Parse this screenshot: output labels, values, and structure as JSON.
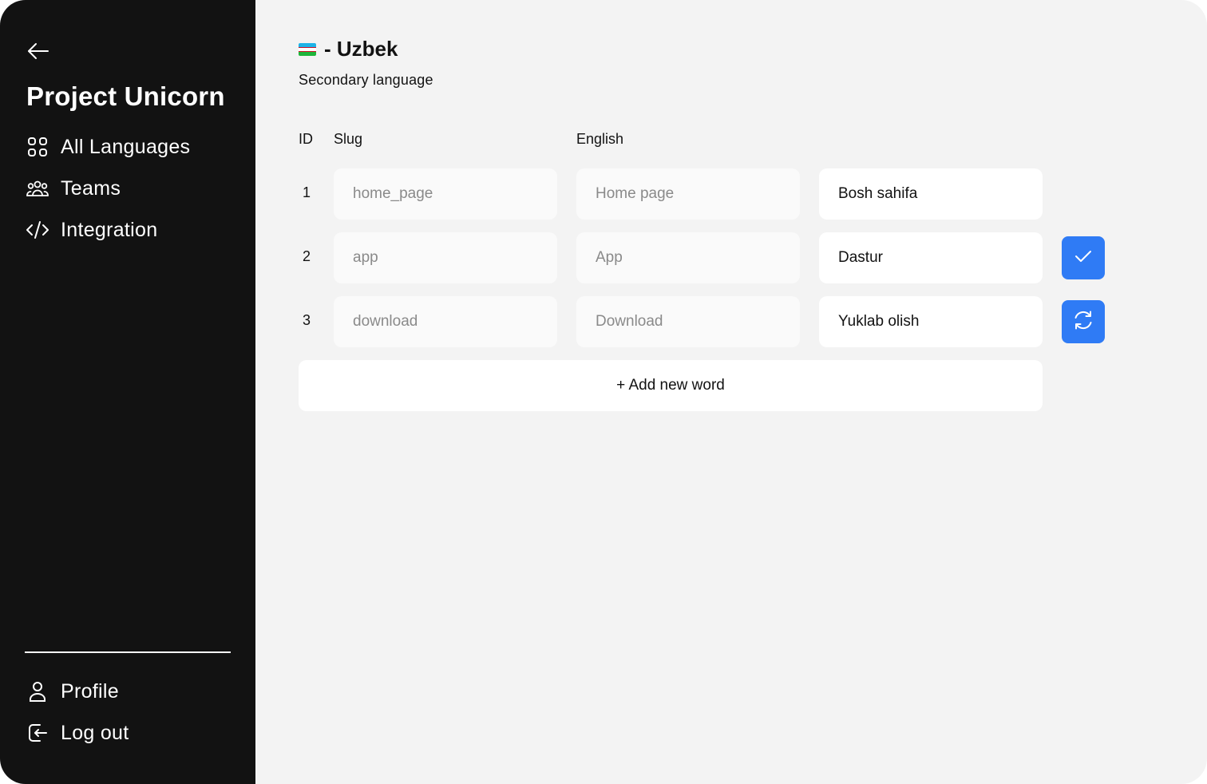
{
  "sidebar": {
    "project_title": "Project Unicorn",
    "nav": [
      {
        "label": "All Languages",
        "icon": "grid-icon"
      },
      {
        "label": "Teams",
        "icon": "users-icon"
      },
      {
        "label": "Integration",
        "icon": "code-icon"
      }
    ],
    "bottom_nav": [
      {
        "label": "Profile",
        "icon": "user-icon"
      },
      {
        "label": "Log out",
        "icon": "logout-icon"
      }
    ]
  },
  "language": {
    "flag": "uzbekistan-flag",
    "title": "- Uzbek",
    "subtitle": "Secondary language"
  },
  "table": {
    "headers": {
      "id": "ID",
      "slug": "Slug",
      "english": "English"
    },
    "rows": [
      {
        "id": "1",
        "slug": "home_page",
        "english": "Home page",
        "translation": "Bosh sahifa",
        "action": null
      },
      {
        "id": "2",
        "slug": "app",
        "english": "App",
        "translation": "Dastur",
        "action": "check-icon"
      },
      {
        "id": "3",
        "slug": "download",
        "english": "Download",
        "translation": "Yuklab olish",
        "action": "refresh-icon"
      }
    ],
    "add_label": "+ Add new word"
  },
  "colors": {
    "sidebar_bg": "#121212",
    "main_bg": "#f3f3f3",
    "accent": "#2f7bf5"
  }
}
